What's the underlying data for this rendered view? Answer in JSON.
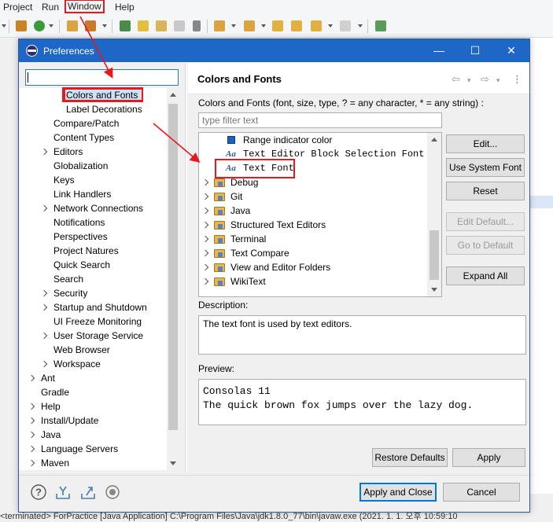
{
  "menubar": {
    "items": [
      "Project",
      "Run",
      "Window",
      "Help"
    ]
  },
  "statusbar": {
    "text": "<terminated> ForPractice [Java Application] C:\\Program Files\\Java\\jdk1.8.0_77\\bin\\javaw.exe (2021. 1. 1. 오후 10:59:10"
  },
  "dialog": {
    "title": "Preferences",
    "controls": {
      "minimize": "—",
      "maximize": "☐",
      "close": "✕"
    },
    "filter_value": "",
    "tree": [
      {
        "label": "Colors and Fonts",
        "expandable": false,
        "indent": 2
      },
      {
        "label": "Label Decorations",
        "expandable": false,
        "indent": 2
      },
      {
        "label": "Compare/Patch",
        "expandable": false,
        "indent": 1
      },
      {
        "label": "Content Types",
        "expandable": false,
        "indent": 1
      },
      {
        "label": "Editors",
        "expandable": true,
        "indent": 1
      },
      {
        "label": "Globalization",
        "expandable": false,
        "indent": 1
      },
      {
        "label": "Keys",
        "expandable": false,
        "indent": 1
      },
      {
        "label": "Link Handlers",
        "expandable": false,
        "indent": 1
      },
      {
        "label": "Network Connections",
        "expandable": true,
        "indent": 1
      },
      {
        "label": "Notifications",
        "expandable": false,
        "indent": 1
      },
      {
        "label": "Perspectives",
        "expandable": false,
        "indent": 1
      },
      {
        "label": "Project Natures",
        "expandable": false,
        "indent": 1
      },
      {
        "label": "Quick Search",
        "expandable": false,
        "indent": 1
      },
      {
        "label": "Search",
        "expandable": false,
        "indent": 1
      },
      {
        "label": "Security",
        "expandable": true,
        "indent": 1
      },
      {
        "label": "Startup and Shutdown",
        "expandable": true,
        "indent": 1
      },
      {
        "label": "UI Freeze Monitoring",
        "expandable": false,
        "indent": 1
      },
      {
        "label": "User Storage Service",
        "expandable": true,
        "indent": 1
      },
      {
        "label": "Web Browser",
        "expandable": false,
        "indent": 1
      },
      {
        "label": "Workspace",
        "expandable": true,
        "indent": 1
      },
      {
        "label": "Ant",
        "expandable": true,
        "indent": 0
      },
      {
        "label": "Gradle",
        "expandable": false,
        "indent": 0
      },
      {
        "label": "Help",
        "expandable": true,
        "indent": 0
      },
      {
        "label": "Install/Update",
        "expandable": true,
        "indent": 0
      },
      {
        "label": "Java",
        "expandable": true,
        "indent": 0
      },
      {
        "label": "Language Servers",
        "expandable": true,
        "indent": 0
      },
      {
        "label": "Maven",
        "expandable": true,
        "indent": 0
      }
    ],
    "page": {
      "heading": "Colors and Fonts",
      "description": "Colors and Fonts (font, size, type, ? = any character, * = any string) :",
      "filter_placeholder": "type filter text",
      "font_tree": [
        {
          "label": "Range indicator color",
          "kind": "color"
        },
        {
          "label": "Text Editor Block Selection Font",
          "kind": "font"
        },
        {
          "label": "Text Font",
          "kind": "font"
        },
        {
          "label": "Debug",
          "kind": "folder"
        },
        {
          "label": "Git",
          "kind": "folder"
        },
        {
          "label": "Java",
          "kind": "folder"
        },
        {
          "label": "Structured Text Editors",
          "kind": "folder"
        },
        {
          "label": "Terminal",
          "kind": "folder"
        },
        {
          "label": "Text Compare",
          "kind": "folder"
        },
        {
          "label": "View and Editor Folders",
          "kind": "folder"
        },
        {
          "label": "WikiText",
          "kind": "folder"
        }
      ],
      "buttons": {
        "edit": "Edit...",
        "use_system_font": "Use System Font",
        "reset": "Reset",
        "edit_default": "Edit Default...",
        "go_to_default": "Go to Default",
        "expand_all": "Expand All"
      },
      "description_label": "Description:",
      "description_text": "The text font is used by text editors.",
      "preview_label": "Preview:",
      "preview_lines": [
        "Consolas 11",
        "The quick brown fox jumps over the lazy dog."
      ],
      "restore_defaults": "Restore Defaults",
      "apply": "Apply"
    },
    "footer": {
      "apply_and_close": "Apply and Close",
      "cancel": "Cancel"
    }
  },
  "colors": {
    "title_bar": "#1e67c7",
    "annotation": "#e8191e",
    "selection": "#cce3f7",
    "default_button_border": "#0078d7"
  }
}
